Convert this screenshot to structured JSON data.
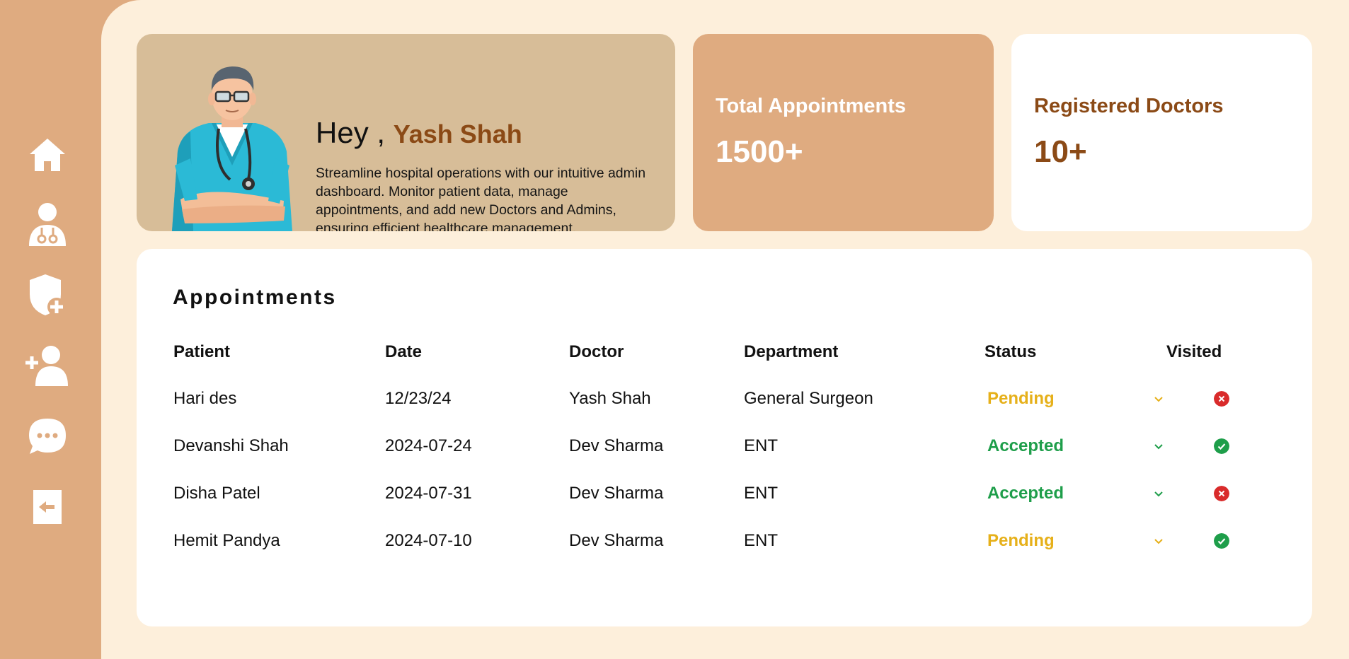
{
  "welcome": {
    "greeting": "Hey ,",
    "name": "Yash Shah",
    "description": "Streamline hospital operations with our intuitive admin dashboard. Monitor patient data, manage appointments, and add new Doctors and Admins, ensuring efficient healthcare management."
  },
  "stats": [
    {
      "label": "Total Appointments",
      "value": "1500+"
    },
    {
      "label": "Registered Doctors",
      "value": "10+"
    }
  ],
  "appointments": {
    "title": "Appointments",
    "headers": [
      "Patient",
      "Date",
      "Doctor",
      "Department",
      "Status",
      "Visited"
    ],
    "rows": [
      {
        "patient": "Hari des",
        "date": "12/23/24",
        "doctor": "Yash Shah",
        "department": "General Surgeon",
        "status": "Pending",
        "visited": false
      },
      {
        "patient": "Devanshi Shah",
        "date": "2024-07-24",
        "doctor": "Dev Sharma",
        "department": "ENT",
        "status": "Accepted",
        "visited": true
      },
      {
        "patient": "Disha Patel",
        "date": "2024-07-31",
        "doctor": "Dev Sharma",
        "department": "ENT",
        "status": "Accepted",
        "visited": false
      },
      {
        "patient": "Hemit Pandya",
        "date": "2024-07-10",
        "doctor": "Dev Sharma",
        "department": "ENT",
        "status": "Pending",
        "visited": true
      }
    ]
  },
  "sidebar": {
    "icons": [
      "home-icon",
      "doctor-icon",
      "shield-add-icon",
      "user-add-icon",
      "chat-icon",
      "logout-icon"
    ]
  },
  "colors": {
    "sidebar": "#DFAB80",
    "background": "#FDEFDB",
    "welcome_card": "#D7BD98",
    "brand_brown": "#8B4A16",
    "pending": "#E6B01A",
    "accepted": "#1E9E4A",
    "not_visited": "#D92B2B"
  }
}
